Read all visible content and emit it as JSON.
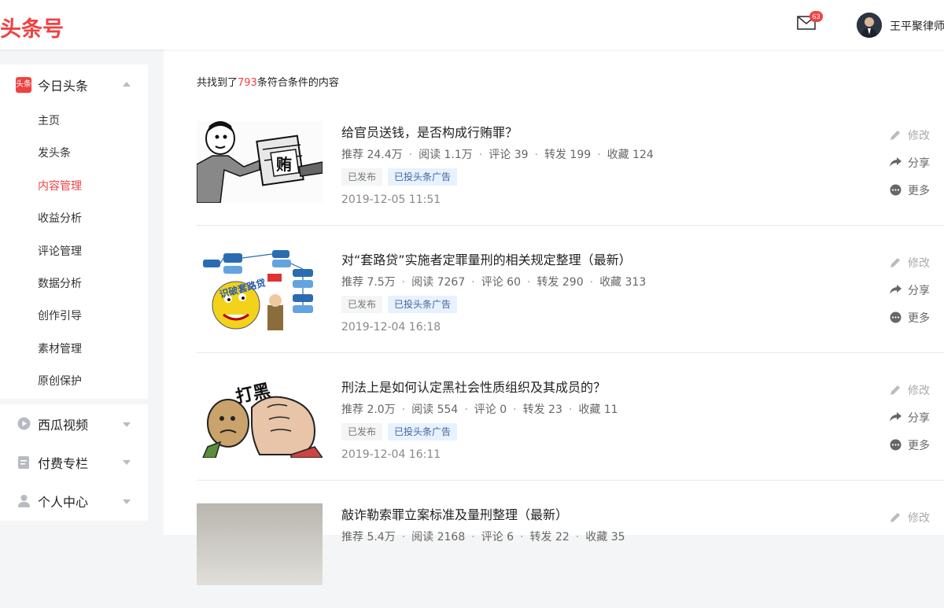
{
  "header": {
    "logo": "头条号",
    "mail_count": "63",
    "username": "王平聚律师"
  },
  "sidebar": {
    "toutiao": {
      "badge": "头条",
      "label": "今日头条",
      "items": [
        "主页",
        "发头条",
        "内容管理",
        "收益分析",
        "评论管理",
        "数据分析",
        "创作引导",
        "素材管理",
        "原创保护"
      ],
      "active_index": 2
    },
    "groups": [
      {
        "label": "西瓜视频",
        "icon": "play-icon"
      },
      {
        "label": "付费专栏",
        "icon": "document-icon"
      },
      {
        "label": "个人中心",
        "icon": "person-icon"
      }
    ]
  },
  "main": {
    "result_prefix": "共找到了",
    "result_count": "793",
    "result_suffix": "条符合条件的内容",
    "articles": [
      {
        "title": "给官员送钱，是否构成行贿罪？",
        "recommend": "推荐 24.4万",
        "read": "阅读 1.1万",
        "comment": "评论 39",
        "forward": "转发 199",
        "favorite": "收藏 124",
        "status": "已发布",
        "ad": "已投头条广告",
        "date": "2019-12-05 11:51",
        "thumb_text": "贿"
      },
      {
        "title": "对“套路贷”实施者定罪量刑的相关规定整理（最新）",
        "recommend": "推荐 7.5万",
        "read": "阅读 7267",
        "comment": "评论 60",
        "forward": "转发 290",
        "favorite": "收藏 313",
        "status": "已发布",
        "ad": "已投头条广告",
        "date": "2019-12-04 16:18",
        "thumb_text": "识破套路贷"
      },
      {
        "title": "刑法上是如何认定黑社会性质组织及其成员的？",
        "recommend": "推荐 2.0万",
        "read": "阅读 554",
        "comment": "评论 0",
        "forward": "转发 23",
        "favorite": "收藏 11",
        "status": "已发布",
        "ad": "已投头条广告",
        "date": "2019-12-04 16:11",
        "thumb_text": "打黑"
      },
      {
        "title": "敲诈勒索罪立案标准及量刑整理（最新）",
        "recommend": "推荐 5.4万",
        "read": "阅读 2168",
        "comment": "评论 6",
        "forward": "转发 22",
        "favorite": "收藏 35"
      }
    ],
    "actions": {
      "edit": "修改",
      "share": "分享",
      "more": "更多"
    }
  },
  "colors": {
    "brand": "#f04142",
    "tag_blue_bg": "#e8f2ff",
    "tag_blue_text": "#406599"
  }
}
